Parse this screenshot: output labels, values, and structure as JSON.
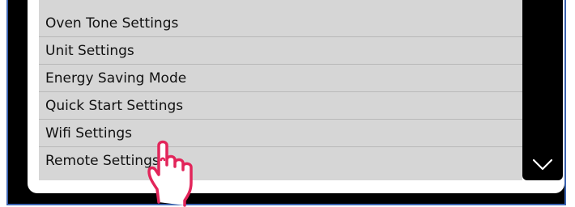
{
  "menu": {
    "items": [
      {
        "label": "Oven Tone Settings"
      },
      {
        "label": "Unit Settings"
      },
      {
        "label": "Energy Saving Mode"
      },
      {
        "label": "Quick Start Settings"
      },
      {
        "label": "Wifi Settings"
      },
      {
        "label": "Remote Settings"
      }
    ]
  },
  "icons": {
    "scroll_down": "chevron-down-icon",
    "pointer": "hand-pointer-icon"
  },
  "colors": {
    "list_bg": "#d6d6d6",
    "frame": "#000000",
    "frame_border": "#3b63b0",
    "hand_stroke": "#e2255a"
  }
}
